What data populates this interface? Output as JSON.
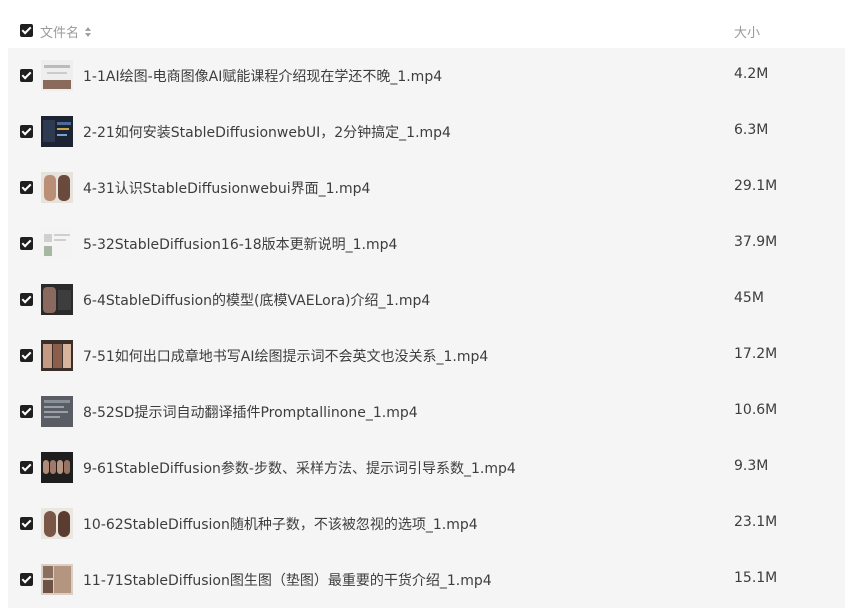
{
  "header": {
    "name_label": "文件名",
    "size_label": "大小"
  },
  "files": [
    {
      "name": "1-1AI绘图-电商图像AI赋能课程介绍现在学还不晚_1.mp4",
      "size": "4.2M"
    },
    {
      "name": "2-21如何安装StableDiffusionwebUI，2分钟搞定_1.mp4",
      "size": "6.3M"
    },
    {
      "name": "4-31认识StableDiffusionwebui界面_1.mp4",
      "size": "29.1M"
    },
    {
      "name": "5-32StableDiffusion16-18版本更新说明_1.mp4",
      "size": "37.9M"
    },
    {
      "name": "6-4StableDiffusion的模型(底模VAELora)介绍_1.mp4",
      "size": "45M"
    },
    {
      "name": "7-51如何出口成章地书写AI绘图提示词不会英文也没关系_1.mp4",
      "size": "17.2M"
    },
    {
      "name": "8-52SD提示词自动翻译插件Promptallinone_1.mp4",
      "size": "10.6M"
    },
    {
      "name": "9-61StableDiffusion参数-步数、采样方法、提示词引导系数_1.mp4",
      "size": "9.3M"
    },
    {
      "name": "10-62StableDiffusion随机种子数，不该被忽视的选项_1.mp4",
      "size": "23.1M"
    },
    {
      "name": "11-71StableDiffusion图生图（垫图）最重要的干货介绍_1.mp4",
      "size": "15.1M"
    }
  ]
}
